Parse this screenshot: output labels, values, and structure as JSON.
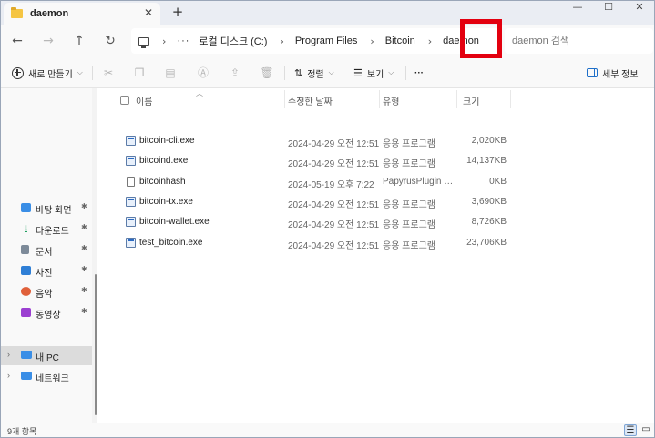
{
  "tab": {
    "title": "daemon",
    "close_glyph": "✕",
    "new_tab_glyph": "+"
  },
  "window_controls": {
    "minimize": "—",
    "maximize": "☐",
    "close": "✕"
  },
  "nav_buttons": {
    "back": "←",
    "forward": "→",
    "up": "↑",
    "refresh": "↻"
  },
  "address": {
    "more": "···",
    "crumbs": [
      "로컬 디스크 (C:)",
      "Program Files",
      "Bitcoin",
      "daemon"
    ],
    "separator": "›"
  },
  "search": {
    "placeholder": "daemon 검색"
  },
  "toolbar": {
    "new_label": "새로 만들기",
    "sort_label": "정렬",
    "view_label": "보기",
    "more": "···",
    "details_label": "세부 정보",
    "icons": [
      "cut-icon",
      "copy-icon",
      "paste-icon",
      "rename-icon",
      "share-icon",
      "delete-icon"
    ]
  },
  "sidebar": {
    "quick_access": [
      {
        "label": "바탕 화면",
        "icon": "desktop-icon",
        "color": "#3a8ee6"
      },
      {
        "label": "다운로드",
        "icon": "download-icon",
        "color": "#1a9c5c"
      },
      {
        "label": "문서",
        "icon": "documents-icon",
        "color": "#7d8a99"
      },
      {
        "label": "사진",
        "icon": "pictures-icon",
        "color": "#2f7fd6"
      },
      {
        "label": "음악",
        "icon": "music-icon",
        "color": "#e0603a"
      },
      {
        "label": "동영상",
        "icon": "videos-icon",
        "color": "#9b3fd1"
      }
    ],
    "pin_glyph": "📌",
    "tree": [
      {
        "label": "내 PC",
        "icon": "this-pc-icon",
        "selected": true
      },
      {
        "label": "네트워크",
        "icon": "network-icon",
        "selected": false
      }
    ]
  },
  "columns": {
    "name": "이름",
    "date": "수정한 날짜",
    "type": "유형",
    "size": "크기"
  },
  "files": [
    {
      "name": "bitcoin-cli.exe",
      "date": "2024-04-29 오전 12:51",
      "type": "응용 프로그램",
      "size": "2,020KB",
      "kind": "exe"
    },
    {
      "name": "bitcoind.exe",
      "date": "2024-04-29 오전 12:51",
      "type": "응용 프로그램",
      "size": "14,137KB",
      "kind": "exe"
    },
    {
      "name": "bitcoinhash",
      "date": "2024-05-19 오후 7:22",
      "type": "PapyrusPlugin Cla...",
      "size": "0KB",
      "kind": "file"
    },
    {
      "name": "bitcoin-tx.exe",
      "date": "2024-04-29 오전 12:51",
      "type": "응용 프로그램",
      "size": "3,690KB",
      "kind": "exe"
    },
    {
      "name": "bitcoin-wallet.exe",
      "date": "2024-04-29 오전 12:51",
      "type": "응용 프로그램",
      "size": "8,726KB",
      "kind": "exe"
    },
    {
      "name": "test_bitcoin.exe",
      "date": "2024-04-29 오전 12:51",
      "type": "응용 프로그램",
      "size": "23,706KB",
      "kind": "exe"
    }
  ],
  "status": {
    "item_count": "9개 항목"
  },
  "colors": {
    "highlight": "#e3000f",
    "accent": "#1e6fc9"
  }
}
